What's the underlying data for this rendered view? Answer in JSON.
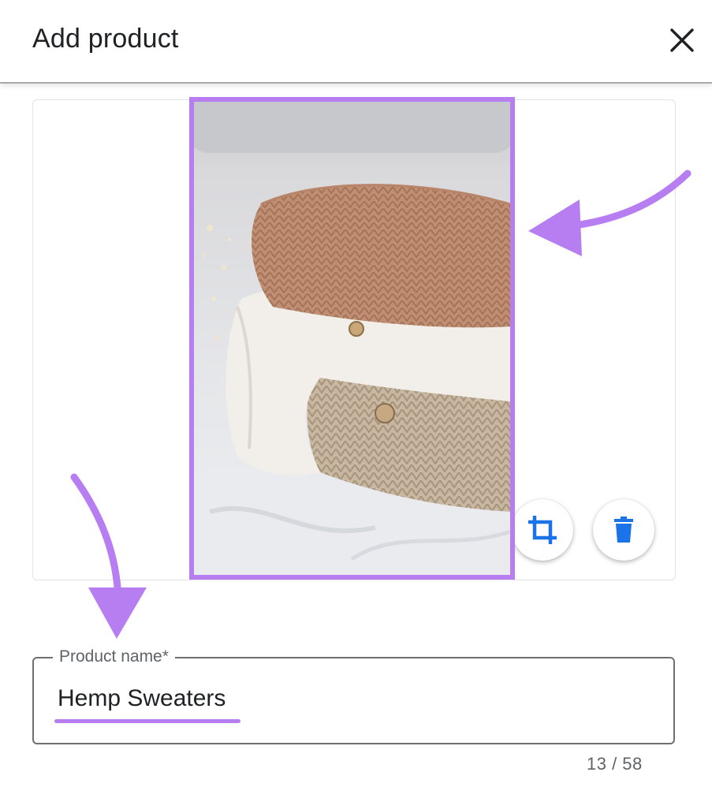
{
  "dialog": {
    "title": "Add product",
    "close_icon": "close-icon"
  },
  "image": {
    "description": "folded knit sweaters on a bed",
    "highlight_color": "#b77ef2",
    "actions": [
      {
        "name": "crop",
        "icon": "crop-icon"
      },
      {
        "name": "delete",
        "icon": "trash-icon"
      }
    ]
  },
  "product_name": {
    "label": "Product name*",
    "value": "Hemp Sweaters",
    "counter": "13 / 58"
  },
  "colors": {
    "accent_purple": "#b77ef2",
    "icon_blue": "#1a73e8",
    "text": "#202124",
    "muted": "#5f6368"
  }
}
